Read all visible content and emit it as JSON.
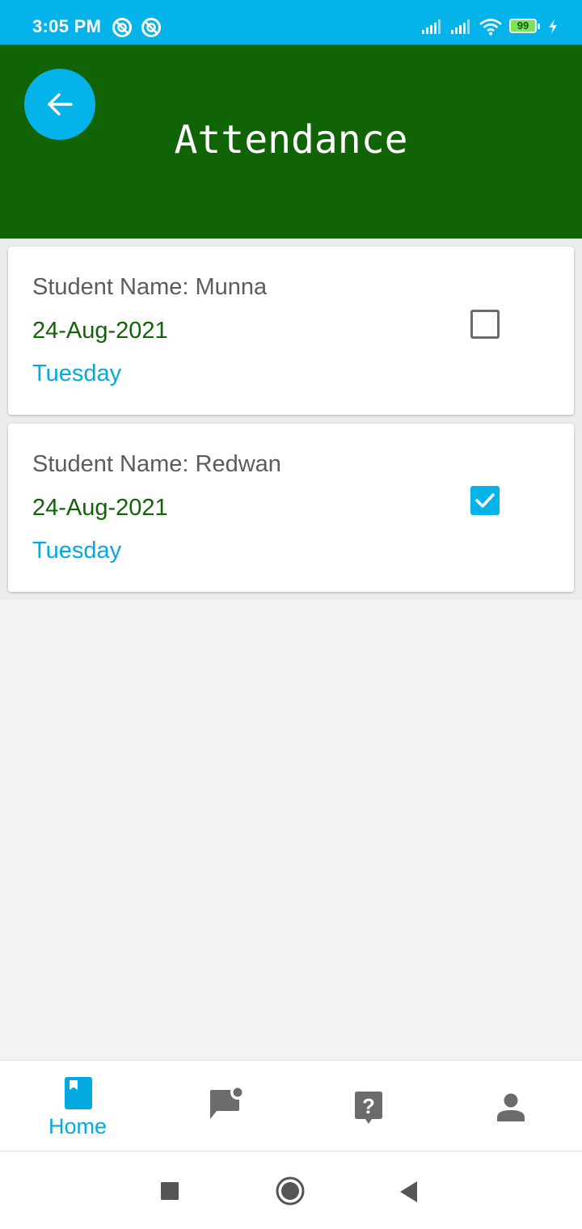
{
  "status_bar": {
    "time": "3:05 PM",
    "battery": "99",
    "icons": [
      "notification-icon",
      "notification-icon",
      "cell-signal-icon",
      "cell-signal-icon",
      "wifi-icon",
      "battery-icon",
      "charging-icon"
    ]
  },
  "header": {
    "title": "Attendance",
    "back_icon": "arrow-left-icon",
    "background_color": "#116406",
    "accent_color": "#03b3ea"
  },
  "attendance": [
    {
      "name": "Student Name: Munna",
      "date": "24-Aug-2021",
      "day": "Tuesday",
      "present": false
    },
    {
      "name": "Student Name: Redwan",
      "date": "24-Aug-2021",
      "day": "Tuesday",
      "present": true
    }
  ],
  "bottom_nav": {
    "items": [
      {
        "label": "Home",
        "icon": "book-icon",
        "active": true
      },
      {
        "label": "",
        "icon": "chat-notification-icon",
        "active": false
      },
      {
        "label": "",
        "icon": "help-icon",
        "active": false
      },
      {
        "label": "",
        "icon": "person-icon",
        "active": false
      }
    ],
    "active_color": "#03a9e1",
    "inactive_color": "#6b6b6b"
  },
  "system_nav": {
    "icons": [
      "recents-square-icon",
      "home-circle-icon",
      "back-triangle-icon"
    ]
  }
}
